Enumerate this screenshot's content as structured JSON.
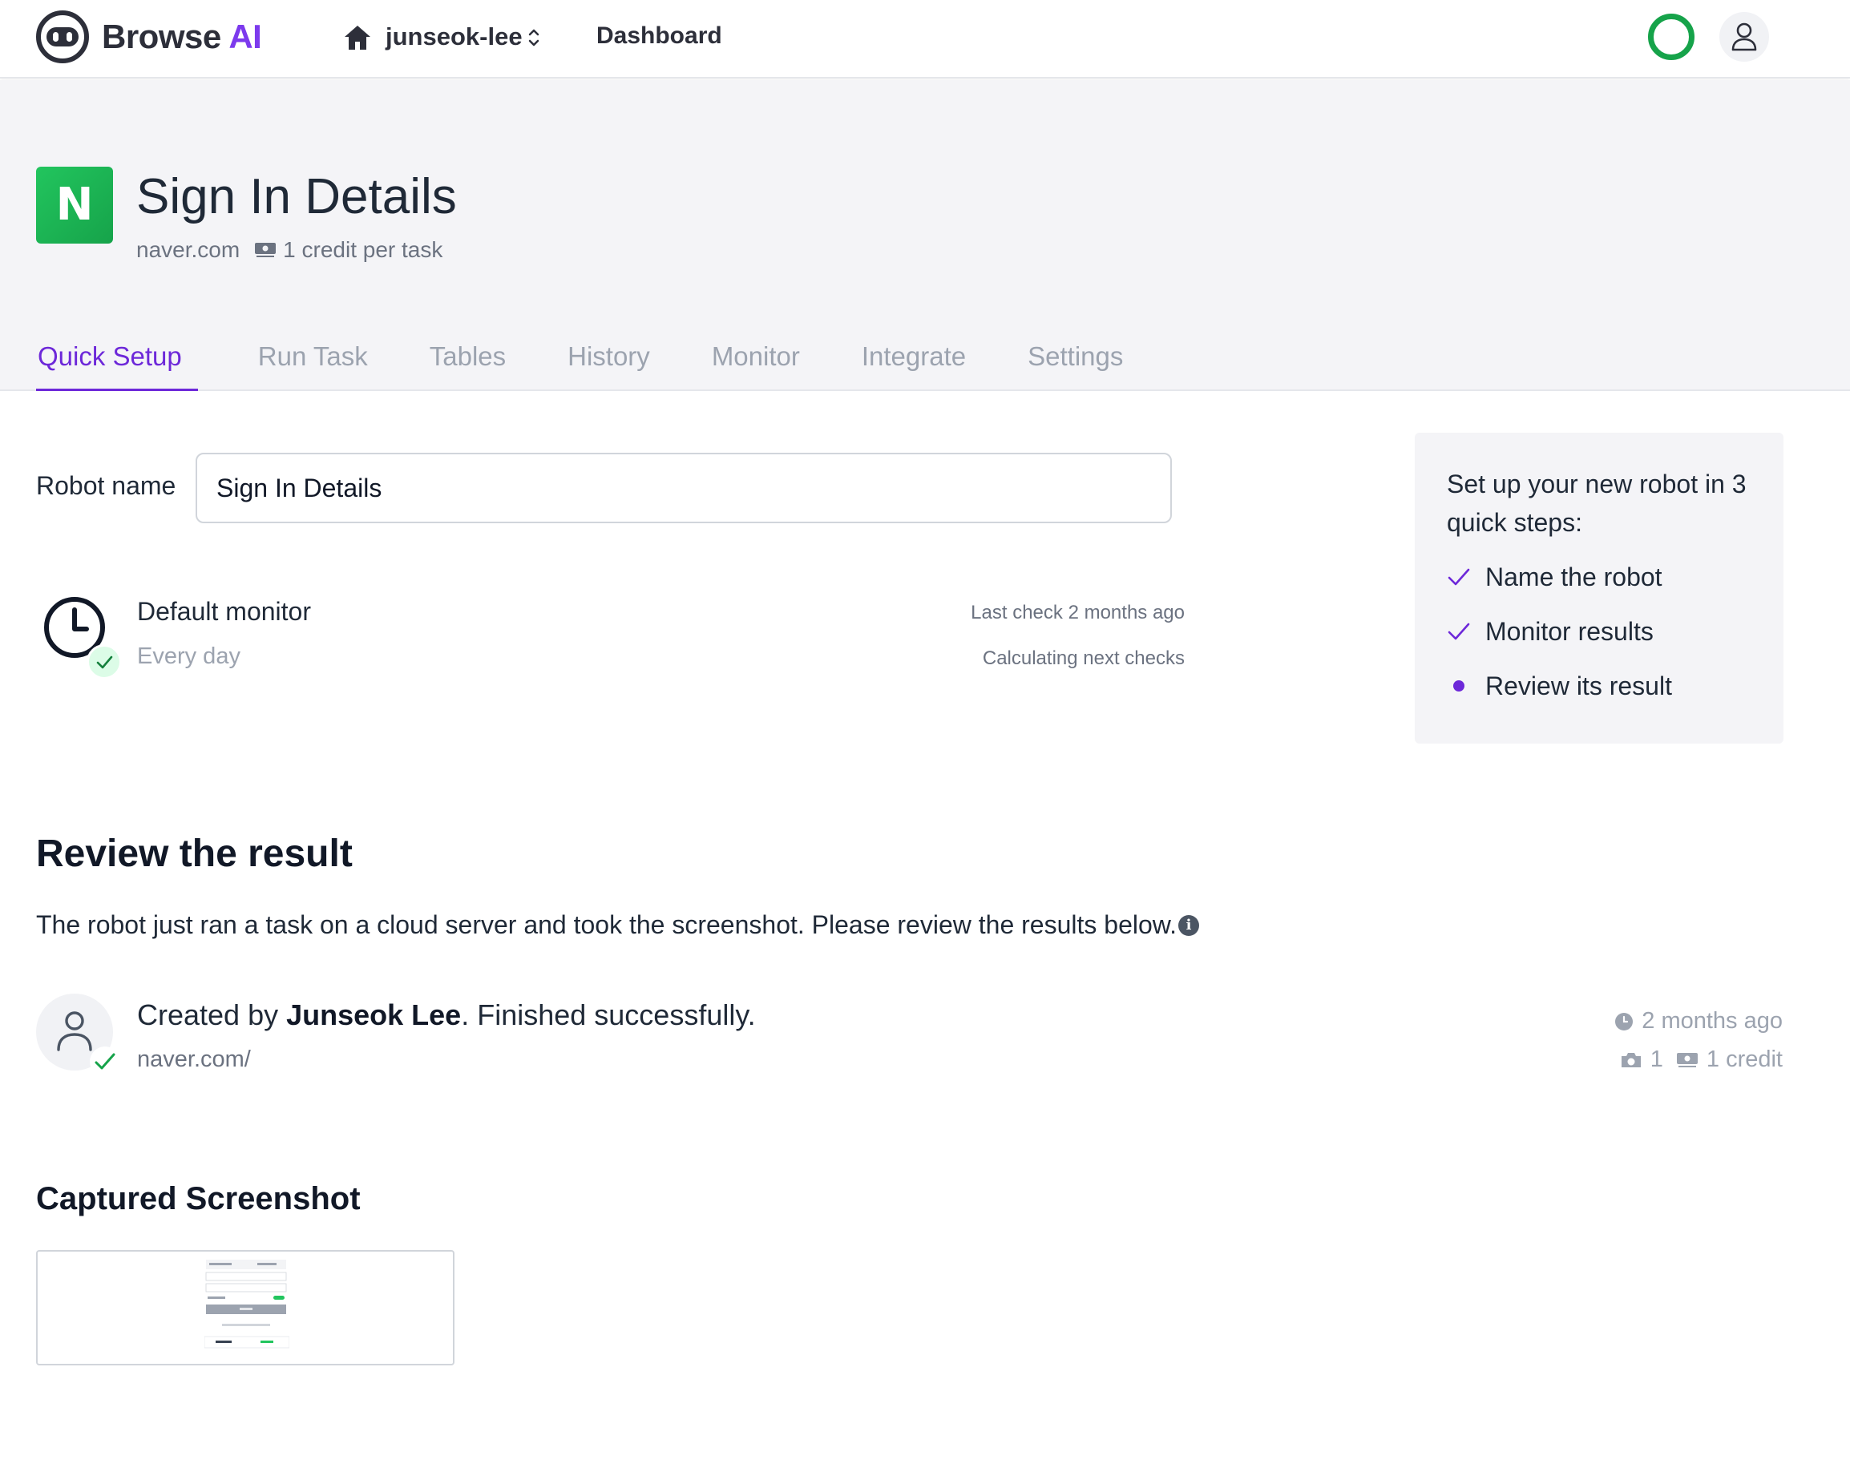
{
  "app": {
    "brand_name": "Browse ",
    "brand_accent": "AI",
    "workspace": "junseok-lee",
    "nav_dashboard": "Dashboard",
    "accent_color": "#6d28d9",
    "status_color": "#16a34a"
  },
  "robot": {
    "logo_letter": "N",
    "title": "Sign In Details",
    "domain": "naver.com",
    "credit_info": "1 credit per task"
  },
  "tabs": [
    {
      "label": "Quick Setup",
      "active": true
    },
    {
      "label": "Run Task",
      "active": false
    },
    {
      "label": "Tables",
      "active": false
    },
    {
      "label": "History",
      "active": false
    },
    {
      "label": "Monitor",
      "active": false
    },
    {
      "label": "Integrate",
      "active": false
    },
    {
      "label": "Settings",
      "active": false
    }
  ],
  "form": {
    "robot_name_label": "Robot name",
    "robot_name_value": "Sign In Details"
  },
  "monitor": {
    "name": "Default monitor",
    "frequency": "Every day",
    "last_check": "Last check 2 months ago",
    "next_check": "Calculating next checks"
  },
  "steps": {
    "title": "Set up your new robot in 3 quick steps:",
    "items": [
      {
        "label": "Name the robot",
        "state": "done",
        "icon": "check-icon"
      },
      {
        "label": "Monitor results",
        "state": "done",
        "icon": "check-icon"
      },
      {
        "label": "Review its result",
        "state": "current",
        "icon": "dot-icon"
      }
    ]
  },
  "review": {
    "title": "Review the result",
    "description": "The robot just ran a task on a cloud server and took the screenshot. Please review the results below.",
    "created_prefix": "Created by ",
    "creator": "Junseok Lee",
    "created_suffix": ". Finished successfully.",
    "url": "naver.com/",
    "time": "2 months ago",
    "screenshots": "1",
    "credits": "1 credit"
  },
  "captured": {
    "title": "Captured Screenshot"
  }
}
